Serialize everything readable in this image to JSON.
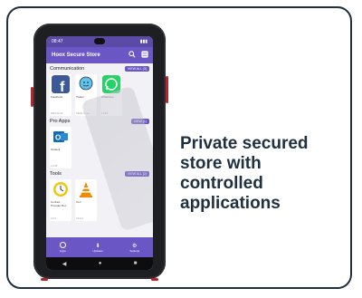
{
  "caption": {
    "line1": "Private secured",
    "line2": "store with",
    "line3": "controlled",
    "line4": "applications"
  },
  "store": {
    "title": "Hoox Secure Store",
    "sections": [
      {
        "name": "Communication",
        "view_all": "VIEW ALL (3)",
        "apps": [
          {
            "name": "Facebook",
            "meta": "2023-10-19",
            "icon": "facebook-icon",
            "color": "#3b5998"
          },
          {
            "name": "Twitter",
            "meta": "TBOIL Innov...",
            "icon": "waze-icon",
            "color": "#5bc4f1"
          },
          {
            "name": "WhatsApp",
            "meta": "2.18.8",
            "icon": "whatsapp-icon",
            "color": "#25d366"
          }
        ]
      },
      {
        "name": "Pro Apps",
        "view_all": "VIEW (1)",
        "apps": [
          {
            "name": "Outlook",
            "meta": "4.0.08",
            "icon": "outlook-icon",
            "color": "#0f6cbd"
          }
        ]
      },
      {
        "name": "Tools",
        "view_all": "VIEW ALL (2)",
        "apps": [
          {
            "name": "Contact Provider Ret...",
            "meta": "2.0.9",
            "icon": "clock-icon",
            "color": "#f2c40d"
          },
          {
            "name": "VLC",
            "meta": "3.6.0-7",
            "icon": "vlc-cone-icon",
            "color": "#f28a00"
          }
        ]
      }
    ],
    "nav": [
      {
        "label": "Apps",
        "icon": "apps-icon"
      },
      {
        "label": "Updates",
        "icon": "download-icon"
      },
      {
        "label": "Settings",
        "icon": "settings-icon"
      }
    ],
    "statusbar": {
      "time": "08:47",
      "battery": "battery-icon"
    }
  }
}
